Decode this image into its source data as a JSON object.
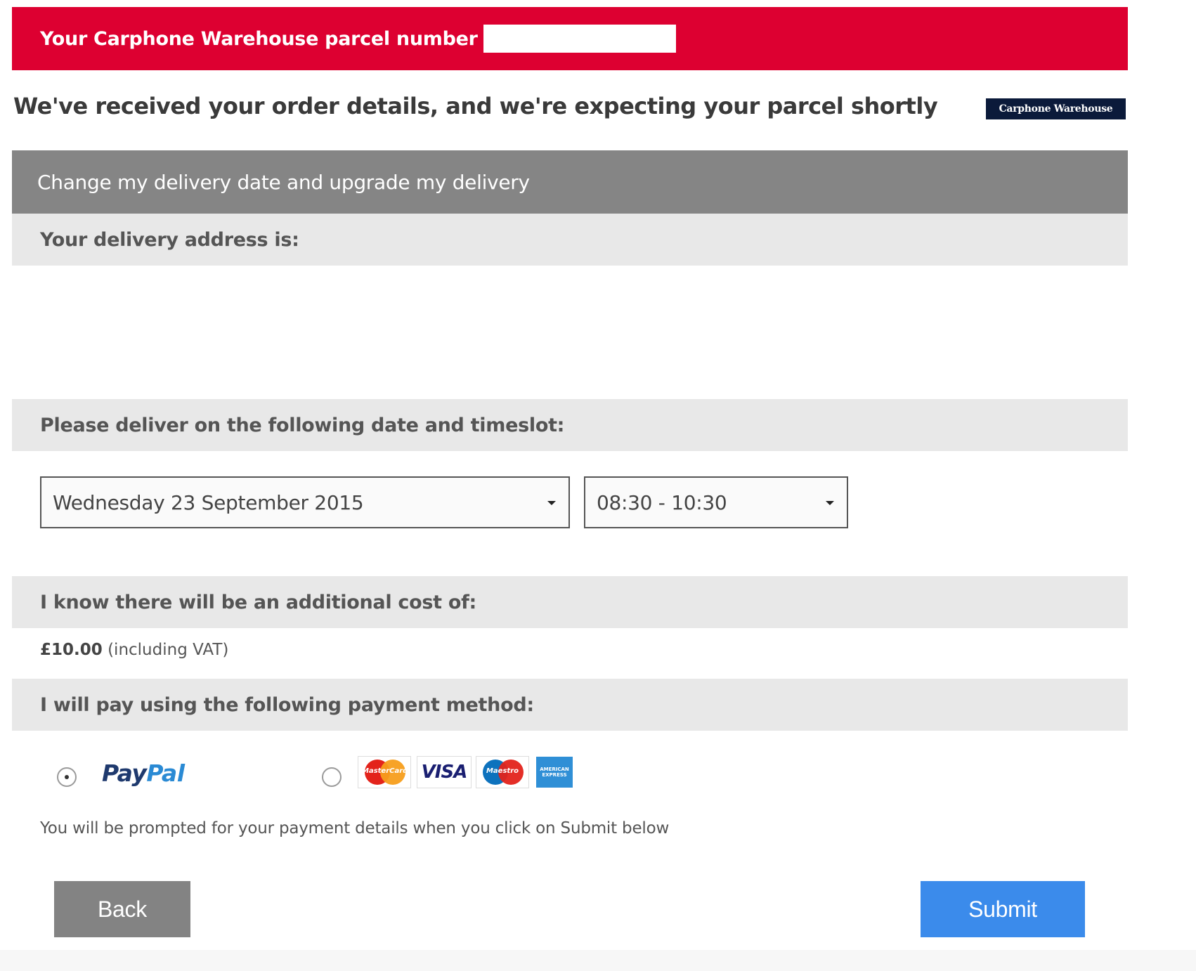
{
  "banner": {
    "text": "Your Carphone Warehouse parcel number"
  },
  "heading": "We've received your order details, and we're expecting your parcel shortly",
  "logo_text": "Carphone Warehouse",
  "change_header": "Change my delivery date and upgrade my delivery",
  "sections": {
    "address_label": "Your delivery address is:",
    "date_label": "Please deliver on the following date and timeslot:",
    "cost_label": "I know there will be an additional cost of:",
    "payment_label": "I will pay using the following payment method:"
  },
  "date_select": {
    "value": "Wednesday 23 September 2015"
  },
  "time_select": {
    "value": "08:30 - 10:30"
  },
  "cost": {
    "amount": "£10.00",
    "note": "(including VAT)"
  },
  "payment": {
    "paypal_pay": "Pay",
    "paypal_pal": "Pal",
    "selected": "paypal",
    "cards": {
      "mastercard": "MasterCard",
      "visa": "VISA",
      "maestro": "Maestro",
      "amex": "AMERICAN EXPRESS"
    }
  },
  "prompt_text": "You will be prompted for your payment details when you click on Submit below",
  "buttons": {
    "back": "Back",
    "submit": "Submit"
  },
  "colors": {
    "banner_red": "#dd0031",
    "header_gray": "#858585",
    "submit_blue": "#3b8beb",
    "back_gray": "#838383"
  }
}
